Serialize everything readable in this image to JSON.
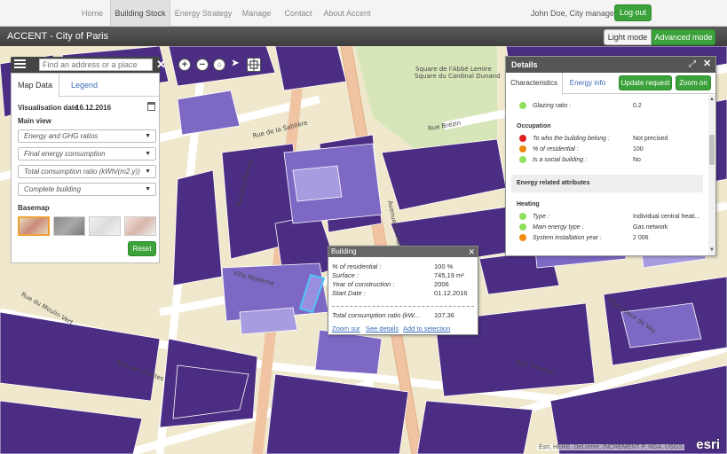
{
  "nav": {
    "items": [
      "Home",
      "Building Stock",
      "Energy Strategy",
      "Manage",
      "Contact",
      "About Accent"
    ],
    "user": "John Doe, City manager",
    "logout": "Log out"
  },
  "titlebar": {
    "title": "ACCENT - City of Paris",
    "light_mode": "Light mode",
    "advanced_mode": "Advanced mode"
  },
  "search": {
    "placeholder": "Find an address or a place",
    "close": "✕"
  },
  "left_panel": {
    "tabs": [
      "Map Data",
      "Legend"
    ],
    "vis_label": "Visualisation date",
    "vis_date": "16.12.2016",
    "main_view": "Main view",
    "selects": [
      "Energy and GHG ratios",
      "Final energy consumption",
      "Total consumption ratio (kWh/(m2.y))",
      "Complete building"
    ],
    "basemap": "Basemap",
    "reset": "Reset"
  },
  "building_popup": {
    "title": "Building",
    "rows": [
      {
        "label": "% of residential :",
        "value": "100 %"
      },
      {
        "label": "Surface :",
        "value": "745,19 m²"
      },
      {
        "label": "Year of construction :",
        "value": "2006"
      },
      {
        "label": "Start Date :",
        "value": "01.12.2016"
      }
    ],
    "total_label": "Total consumption ratio (kW...",
    "total_value": "107,36",
    "links": [
      "Zoom sur",
      "See details",
      "Add to selection"
    ]
  },
  "details": {
    "title": "Details",
    "tabs": [
      "Characteristics",
      "Energy info"
    ],
    "update_btn": "Update request",
    "zoom_btn": "Zoom on",
    "glazing": {
      "label": "Glazing ratio :",
      "value": "0.2",
      "color": "#8fe05a"
    },
    "occupation_title": "Occupation",
    "occupation": [
      {
        "label": "To who the building belong :",
        "value": "Not precised",
        "color": "#e02020"
      },
      {
        "label": "% of residential :",
        "value": "100",
        "color": "#f08a10"
      },
      {
        "label": "Is a social building :",
        "value": "No",
        "color": "#8fe05a"
      }
    ],
    "energy_attr": "Energy related attributes",
    "heating_title": "Heating",
    "heating": [
      {
        "label": "Type :",
        "value": "Individual central heati...",
        "color": "#8fe05a"
      },
      {
        "label": "Main energy type :",
        "value": "Gas network",
        "color": "#8fe05a"
      },
      {
        "label": "System installation year :",
        "value": "2 006",
        "color": "#f08a10"
      }
    ]
  },
  "map": {
    "streets": [
      "Rue de la Sablière",
      "Rue des Plantes",
      "Avenue du Maine",
      "Rue Brézin",
      "Villa Moderne",
      "Rue du Moulin Vert",
      "Rue Thibaud",
      "Villa Coeur de Vey",
      "Square de l'Abbé Lemire",
      "Square du Cardinal Dunand",
      "Rue des Plantes"
    ],
    "attribution": "Esri, HERE, DeLorme, INCREMENT P, NGA, USGS",
    "logo": "esri"
  }
}
